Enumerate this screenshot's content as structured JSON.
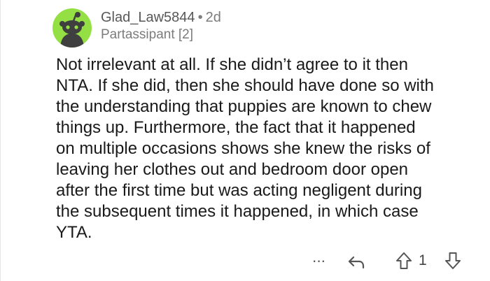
{
  "comment": {
    "author": "Glad_Law5844",
    "separator": "•",
    "age": "2d",
    "flair": "Partassipant [2]",
    "body": "Not irrelevant at all.  If she didn’t agree to it then\nNTA.  If she did, then she should have done so with\nthe understanding that puppies are known to chew\nthings up.  Furthermore, the fact that it happened\non multiple occasions shows she knew the risks of\nleaving her clothes out and bedroom door open\nafter the first time but was acting negligent during\nthe subsequent times it happened, in which case\nYTA."
  },
  "actions": {
    "more": "···",
    "vote_count": "1"
  },
  "icons": {
    "avatar": "reddit-snoo-avatar",
    "more": "more-options-icon",
    "reply": "reply-icon",
    "upvote": "upvote-icon",
    "downvote": "downvote-icon"
  },
  "colors": {
    "avatar_bg": "#94e044",
    "text": "#1a1a1b",
    "meta": "#7c7c7c"
  }
}
